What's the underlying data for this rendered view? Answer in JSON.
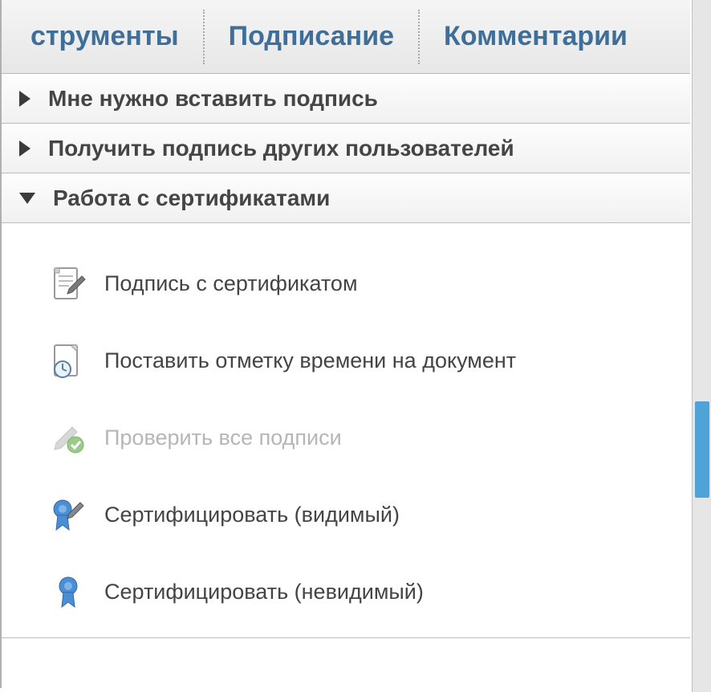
{
  "tabs": {
    "tools": "струменты",
    "signing": "Подписание",
    "comments": "Комментарии"
  },
  "sections": {
    "insert_signature": "Мне нужно вставить подпись",
    "get_others_signature": "Получить подпись других пользователей",
    "certificates": "Работа с сертификатами"
  },
  "cert_items": {
    "sign_with_cert": "Подпись с сертификатом",
    "timestamp_doc": "Поставить отметку времени на документ",
    "validate_all": "Проверить все подписи",
    "certify_visible": "Сертифицировать (видимый)",
    "certify_invisible": "Сертифицировать (невидимый)"
  }
}
